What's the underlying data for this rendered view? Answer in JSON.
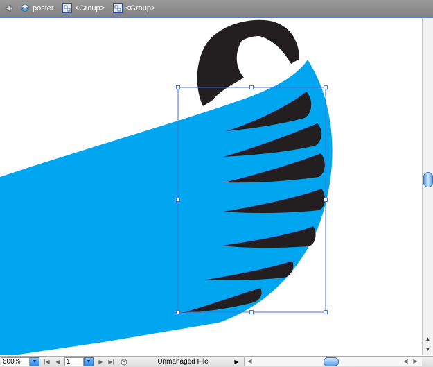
{
  "breadcrumb": {
    "back_icon": "back-arrow-icon",
    "items": [
      {
        "label": "poster",
        "icon": "document-icon"
      },
      {
        "label": "<Group>",
        "icon": "group-icon"
      },
      {
        "label": "<Group>",
        "icon": "group-icon"
      }
    ]
  },
  "statusbar": {
    "zoom_value": "600%",
    "page_value": "1",
    "status_text": "Unmanaged File"
  },
  "colors": {
    "shape_blue": "#00a6f0",
    "shape_dark": "#231f20",
    "selection": "#4a6fd8",
    "topbar_line": "#5b78c9"
  }
}
